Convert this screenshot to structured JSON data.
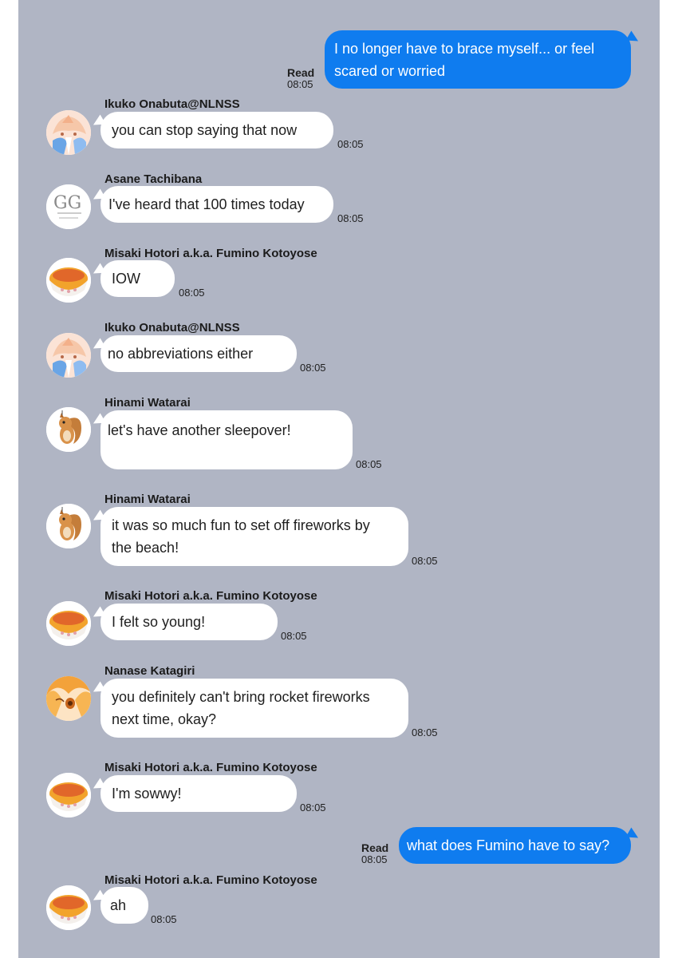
{
  "chat": {
    "outgoing": [
      {
        "text": "I no longer have to brace myself... or feel\nscared or worried",
        "read": "Read",
        "time": "08:05"
      },
      {
        "text": "what does Fumino have to say?",
        "read": "Read",
        "time": "08:05"
      }
    ],
    "messages": [
      {
        "sender": "Ikuko Onabuta@NLNSS",
        "text": "you can stop saying that now",
        "time": "08:05",
        "avatar": "ikuko-avatar"
      },
      {
        "sender": "Asane Tachibana",
        "text": "I've heard that 100 times today",
        "time": "08:05",
        "avatar": "asane-avatar"
      },
      {
        "sender": "Misaki Hotori a.k.a. Fumino Kotoyose",
        "text": "IOW",
        "time": "08:05",
        "avatar": "misaki-avatar"
      },
      {
        "sender": "Ikuko Onabuta@NLNSS",
        "text": "no abbreviations either",
        "time": "08:05",
        "avatar": "ikuko-avatar"
      },
      {
        "sender": "Hinami Watarai",
        "text": "let's have another sleepover!",
        "time": "08:05",
        "avatar": "hinami-avatar"
      },
      {
        "sender": "Hinami Watarai",
        "text": "it was so much fun to set off fireworks by\nthe beach!",
        "time": "08:05",
        "avatar": "hinami-avatar"
      },
      {
        "sender": "Misaki Hotori a.k.a. Fumino Kotoyose",
        "text": "I felt so young!",
        "time": "08:05",
        "avatar": "misaki-avatar"
      },
      {
        "sender": "Nanase Katagiri",
        "text": "you definitely can't bring rocket fireworks\nnext time, okay?",
        "time": "08:05",
        "avatar": "nanase-avatar"
      },
      {
        "sender": "Misaki Hotori a.k.a. Fumino Kotoyose",
        "text": "I'm sowwy!",
        "time": "08:05",
        "avatar": "misaki-avatar"
      },
      {
        "sender": "Misaki Hotori a.k.a. Fumino Kotoyose",
        "text": "ah",
        "time": "08:05",
        "avatar": "misaki-avatar"
      }
    ],
    "avatar_text": {
      "asane": "GG"
    }
  },
  "colors": {
    "background": "#b0b5c4",
    "outgoing_bubble": "#0f7cef",
    "incoming_bubble": "#ffffff"
  }
}
